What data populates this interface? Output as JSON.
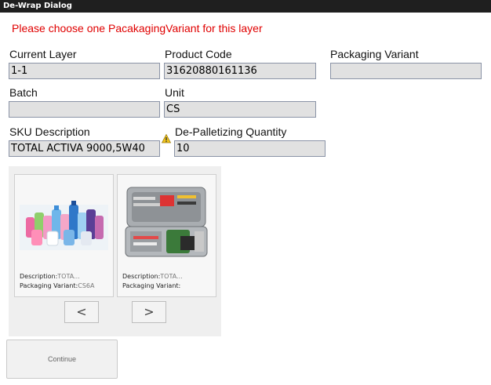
{
  "dialog": {
    "title": "De-Wrap Dialog"
  },
  "message": "Please choose one PacakagingVariant for this layer",
  "fields": {
    "current_layer": {
      "label": "Current Layer",
      "value": "1-1"
    },
    "product_code": {
      "label": "Product Code",
      "value": "31620880161136"
    },
    "packaging_variant": {
      "label": "Packaging Variant",
      "value": ""
    },
    "batch": {
      "label": "Batch",
      "value": ""
    },
    "unit": {
      "label": "Unit",
      "value": "CS"
    },
    "sku_description": {
      "label": "SKU Description",
      "value": "TOTAL ACTIVA 9000,5W40"
    },
    "depalletizing_quantity": {
      "label": "De-Palletizing Quantity",
      "value": "10"
    }
  },
  "variants": [
    {
      "image": "detergent-bottles-photo",
      "description_label": "Description:",
      "description_value": "TOTA...",
      "packaging_label": "Packaging Variant:",
      "packaging_value": "CS6A"
    },
    {
      "image": "toolkit-case-photo",
      "description_label": "Description:",
      "description_value": "TOTA...",
      "packaging_label": "Packaging Variant:",
      "packaging_value": ""
    }
  ],
  "nav": {
    "prev_label": "<",
    "next_label": ">"
  },
  "buttons": {
    "continue_label": "Continue"
  },
  "colors": {
    "warning": "#e00000",
    "titlebar": "#1f1f1f",
    "field_bg": "#e1e1e1"
  }
}
